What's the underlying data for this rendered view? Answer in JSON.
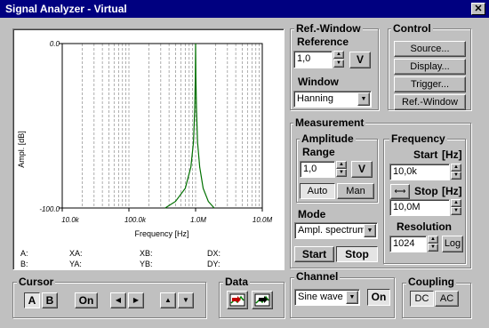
{
  "window": {
    "title": "Signal Analyzer - Virtual",
    "close": "✕"
  },
  "graph": {
    "y_label": "Ampl. [dB]",
    "x_label": "Frequency [Hz]",
    "y_ticks": [
      "0.0",
      "-100.0"
    ],
    "x_ticks": [
      "10.0k",
      "100.0k",
      "1.0M",
      "10.0M"
    ],
    "readouts": {
      "a": "A:",
      "b": "B:",
      "xa": "XA:",
      "ya": "YA:",
      "xb": "XB:",
      "yb": "YB:",
      "dx": "DX:",
      "dy": "DY:"
    }
  },
  "chart_data": {
    "type": "line",
    "xscale": "log",
    "xlim": [
      10000,
      10000000
    ],
    "ylim": [
      -100,
      0
    ],
    "xlabel": "Frequency [Hz]",
    "ylabel": "Ampl. [dB]",
    "grid": "vertical",
    "series": [
      {
        "color": "#007000",
        "x": [
          350000,
          500000,
          700000,
          850000,
          930000,
          970000,
          990000,
          1000000,
          1010000,
          1030000,
          1070000,
          1150000,
          1300000,
          1550000,
          1900000
        ],
        "y": [
          -100,
          -96,
          -88,
          -75,
          -60,
          -40,
          -20,
          0,
          -20,
          -40,
          -60,
          -75,
          -88,
          -96,
          -100
        ]
      }
    ]
  },
  "ref_window": {
    "title": "Ref.-Window",
    "reference_label": "Reference",
    "reference_value": "1,0",
    "reference_unit": "V",
    "window_label": "Window",
    "window_value": "Hanning"
  },
  "control": {
    "title": "Control",
    "source": "Source...",
    "display": "Display...",
    "trigger": "Trigger...",
    "ref_window": "Ref.-Window"
  },
  "measurement": {
    "title": "Measurement",
    "amplitude": {
      "title": "Amplitude",
      "range_label": "Range",
      "range_value": "1,0",
      "range_unit": "V",
      "auto": "Auto",
      "man": "Man"
    },
    "mode": {
      "label": "Mode",
      "value": "Ampl. spectrum",
      "start": "Start",
      "stop": "Stop"
    },
    "frequency": {
      "title": "Frequency",
      "start_label": "Start",
      "start_unit": "[Hz]",
      "start_value": "10,0k",
      "stop_label": "Stop",
      "stop_unit": "[Hz]",
      "stop_value": "10,0M",
      "resolution_label": "Resolution",
      "resolution_value": "1024",
      "log": "Log"
    }
  },
  "cursor": {
    "title": "Cursor",
    "a": "A",
    "b": "B",
    "on": "On"
  },
  "data": {
    "title": "Data"
  },
  "channel": {
    "title": "Channel",
    "value": "Sine wave",
    "on": "On"
  },
  "coupling": {
    "title": "Coupling",
    "dc": "DC",
    "ac": "AC"
  }
}
